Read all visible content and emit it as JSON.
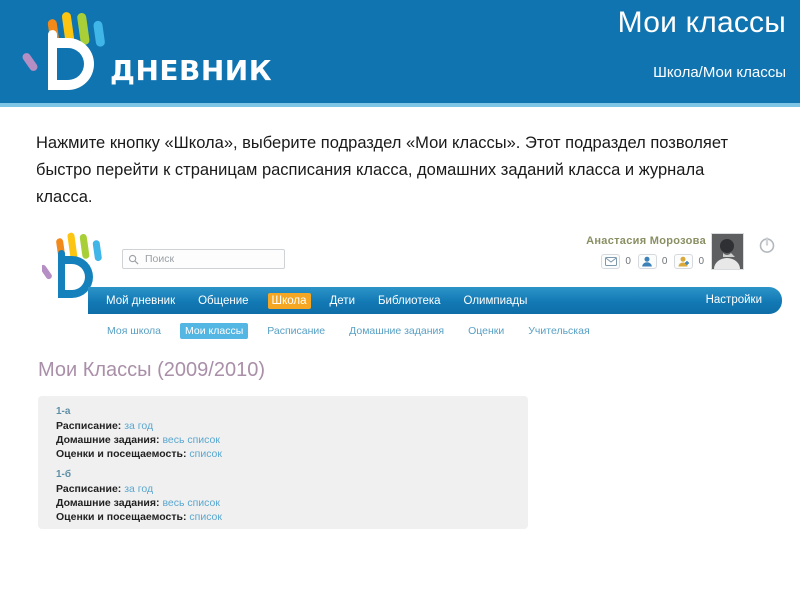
{
  "header": {
    "brand_word": "Дневник",
    "brand_logo_name": "dnevnik-hand-logo",
    "title": "Мои классы",
    "breadcrumb": "Школа/Мои классы",
    "bg_color": "#0f74b0",
    "underline_color": "#7ec4e4"
  },
  "description": {
    "text": "Нажмите кнопку «Школа», выберите подраздел «Мои классы». Этот подраздел позволяет быстро перейти к страницам расписания класса, домашних заданий класса и журнала класса."
  },
  "screenshot": {
    "search": {
      "placeholder": "Поиск",
      "value": "",
      "icon": "search-icon"
    },
    "user": {
      "name": "Анастасия Морозова",
      "avatar_icon": "user-avatar-photo",
      "logout_icon": "power-icon",
      "counters": [
        {
          "icon": "envelope-icon",
          "count": "0"
        },
        {
          "icon": "user-icon",
          "count": "0"
        },
        {
          "icon": "user-add-icon",
          "count": "0"
        }
      ]
    },
    "nav": {
      "items": [
        {
          "label": "Мой дневник",
          "active": false
        },
        {
          "label": "Общение",
          "active": false
        },
        {
          "label": "Школа",
          "active": true
        },
        {
          "label": "Дети",
          "active": false
        },
        {
          "label": "Библиотека",
          "active": false
        },
        {
          "label": "Олимпиады",
          "active": false
        }
      ],
      "settings_label": "Настройки",
      "active_color": "#f5a623",
      "bar_color": "#1279b4"
    },
    "subnav": {
      "items": [
        {
          "label": "Моя школа",
          "active": false
        },
        {
          "label": "Мои классы",
          "active": true
        },
        {
          "label": "Расписание",
          "active": false
        },
        {
          "label": "Домашние задания",
          "active": false
        },
        {
          "label": "Оценки",
          "active": false
        },
        {
          "label": "Учительская",
          "active": false
        }
      ],
      "active_color": "#54b6e3"
    },
    "page_heading": "Мои Классы (2009/2010)",
    "classes": [
      {
        "name": "1-а",
        "rows": [
          {
            "label": "Расписание:",
            "link": "за год"
          },
          {
            "label": "Домашние задания:",
            "link": "весь список"
          },
          {
            "label": "Оценки и посещаемость:",
            "link": "список"
          }
        ]
      },
      {
        "name": "1-б",
        "rows": [
          {
            "label": "Расписание:",
            "link": "за год"
          },
          {
            "label": "Домашние задания:",
            "link": "весь список"
          },
          {
            "label": "Оценки и посещаемость:",
            "link": "список"
          }
        ]
      }
    ]
  }
}
